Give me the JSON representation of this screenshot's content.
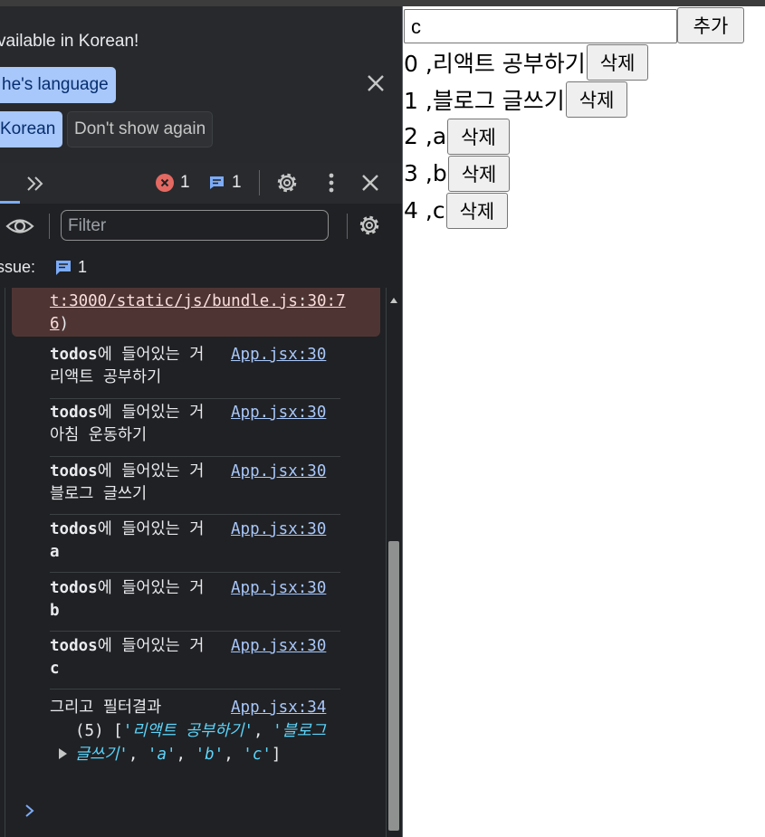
{
  "devtools": {
    "language_banner": {
      "message": "vailable in Korean!",
      "always_match_button": "he's language",
      "switch_button": "Korean",
      "dont_show_button": "Don't show again"
    },
    "tabbar": {
      "error_count": "1",
      "message_count": "1"
    },
    "filter": {
      "placeholder": "Filter"
    },
    "issues": {
      "label": "ssue:",
      "count": "1"
    },
    "console": {
      "error_link": "t:3000/static/js/bundle.js:30:76",
      "error_close_paren": ")",
      "logs": [
        {
          "prefix": "todos",
          "text": "에 들어있는 거 ",
          "value": "리액트 공부하기",
          "source": "App.jsx:30"
        },
        {
          "prefix": "todos",
          "text": "에 들어있는 거 ",
          "value": "아침 운동하기",
          "source": "App.jsx:30"
        },
        {
          "prefix": "todos",
          "text": "에 들어있는 거 ",
          "value": "블로그 글쓰기",
          "source": "App.jsx:30"
        },
        {
          "prefix": "todos",
          "text": "에 들어있는 거 ",
          "value": "a",
          "source": "App.jsx:30"
        },
        {
          "prefix": "todos",
          "text": "에 들어있는 거 ",
          "value": "b",
          "source": "App.jsx:30"
        },
        {
          "prefix": "todos",
          "text": "에 들어있는 거 ",
          "value": "c",
          "source": "App.jsx:30"
        }
      ],
      "filter_result": {
        "title": "그리고 필터결과",
        "source": "App.jsx:34",
        "count": "(5)",
        "items": [
          "'리액트 공부하기'",
          "'블로그 글쓰기'",
          "'a'",
          "'b'",
          "'c'"
        ]
      }
    }
  },
  "app": {
    "input_value": "c",
    "add_button": "추가",
    "delete_label": "삭제",
    "todos": [
      {
        "index": "0",
        "text": "리액트 공부하기"
      },
      {
        "index": "1",
        "text": "블로그 글쓰기"
      },
      {
        "index": "2",
        "text": "a"
      },
      {
        "index": "3",
        "text": "b"
      },
      {
        "index": "4",
        "text": "c"
      }
    ]
  },
  "colors": {
    "devtools_bg": "#202124",
    "banner_button": "#a8c7fa",
    "error_red": "#e46962",
    "link_blue": "#a8c7fa",
    "string_cyan": "#5cd5fb"
  },
  "icons": [
    "close-icon",
    "chevron-double-right-icon",
    "error-icon",
    "message-icon",
    "gear-icon",
    "kebab-menu-icon",
    "eye-icon",
    "issue-icon",
    "expand-triangle-icon",
    "prompt-chevron-icon"
  ]
}
